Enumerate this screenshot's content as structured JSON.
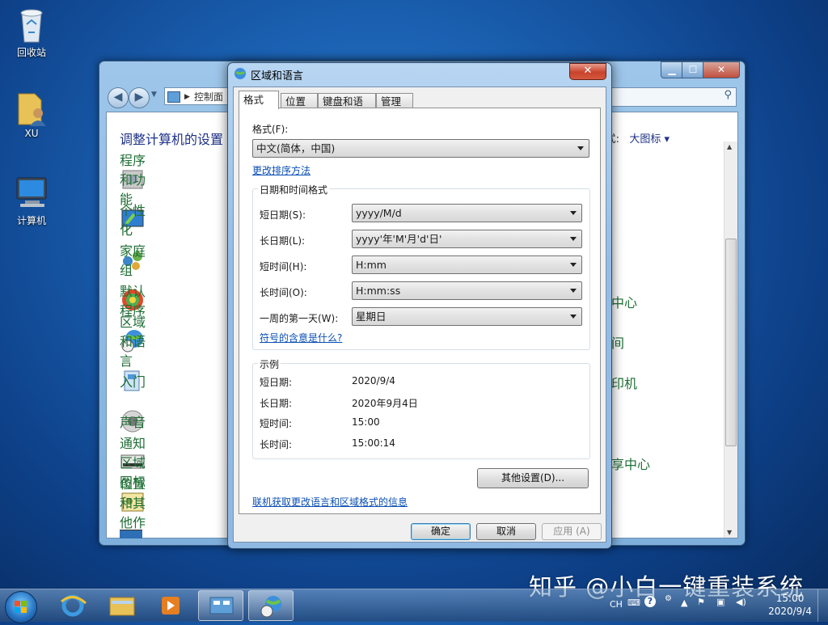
{
  "desktop": {
    "icons": [
      {
        "label": "回收站"
      },
      {
        "label": "XU"
      },
      {
        "label": "计算机"
      }
    ]
  },
  "control_panel": {
    "address": "控制面",
    "heading": "调整计算机的设置",
    "view_by_label": "式:",
    "view_value": "大图标 ▾",
    "items": [
      {
        "label": "程序和功能"
      },
      {
        "label": "个性化"
      },
      {
        "label": "家庭组"
      },
      {
        "label": "默认程序"
      },
      {
        "label": "区域和语言"
      },
      {
        "label": "入门"
      },
      {
        "label": "声音"
      },
      {
        "label": "通知区域图标"
      },
      {
        "label": "位置和其他作"
      }
    ],
    "right_fragments": [
      "中心",
      "间",
      "印机",
      "享中心"
    ],
    "controls": {
      "minimize": "▁",
      "maximize": "☐",
      "close": "✕"
    }
  },
  "dialog": {
    "title": "区域和语言",
    "close": "✕",
    "tabs": [
      "格式",
      "位置",
      "键盘和语言",
      "管理"
    ],
    "format_label": "格式(F):",
    "format_value": "中文(简体，中国)",
    "sort_link": "更改排序方法",
    "datetime_group": "日期和时间格式",
    "fields": [
      {
        "label": "短日期(S):",
        "value": "yyyy/M/d"
      },
      {
        "label": "长日期(L):",
        "value": "yyyy'年'M'月'd'日'"
      },
      {
        "label": "短时间(H):",
        "value": "H:mm"
      },
      {
        "label": "长时间(O):",
        "value": "H:mm:ss"
      },
      {
        "label": "一周的第一天(W):",
        "value": "星期日"
      }
    ],
    "symbols_link": "符号的含意是什么?",
    "example_group": "示例",
    "examples": [
      {
        "label": "短日期:",
        "value": "2020/9/4"
      },
      {
        "label": "长日期:",
        "value": "2020年9月4日"
      },
      {
        "label": "短时间:",
        "value": "15:00"
      },
      {
        "label": "长时间:",
        "value": "15:00:14"
      }
    ],
    "other_settings": "其他设置(D)...",
    "online_link": "联机获取更改语言和区域格式的信息",
    "ok": "确定",
    "cancel": "取消",
    "apply": "应用 (A)"
  },
  "taskbar": {
    "lang": "CH",
    "time": "15:00",
    "date": "2020/9/4"
  },
  "watermark": "知乎 @小白一键重装系统"
}
